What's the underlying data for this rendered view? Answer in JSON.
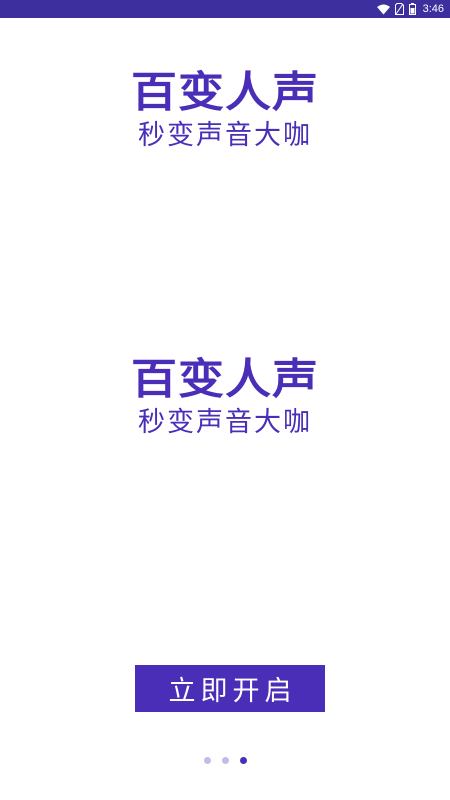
{
  "status_bar": {
    "time": "3:46",
    "icons": [
      "wifi-icon",
      "no-sim-icon",
      "battery-icon"
    ]
  },
  "brand_top": {
    "title": "百变人声",
    "slogan": "秒变声音大咖"
  },
  "brand_middle": {
    "title": "百变人声",
    "slogan": "秒变声音大咖"
  },
  "start_button": {
    "label": "立即开启"
  },
  "pager": {
    "count": 3,
    "active_index": 2
  },
  "colors": {
    "status_bar": "#3d2f9e",
    "brand": "#4a2eb8",
    "dot_inactive": "#c3bce6",
    "background": "#ffffff"
  }
}
